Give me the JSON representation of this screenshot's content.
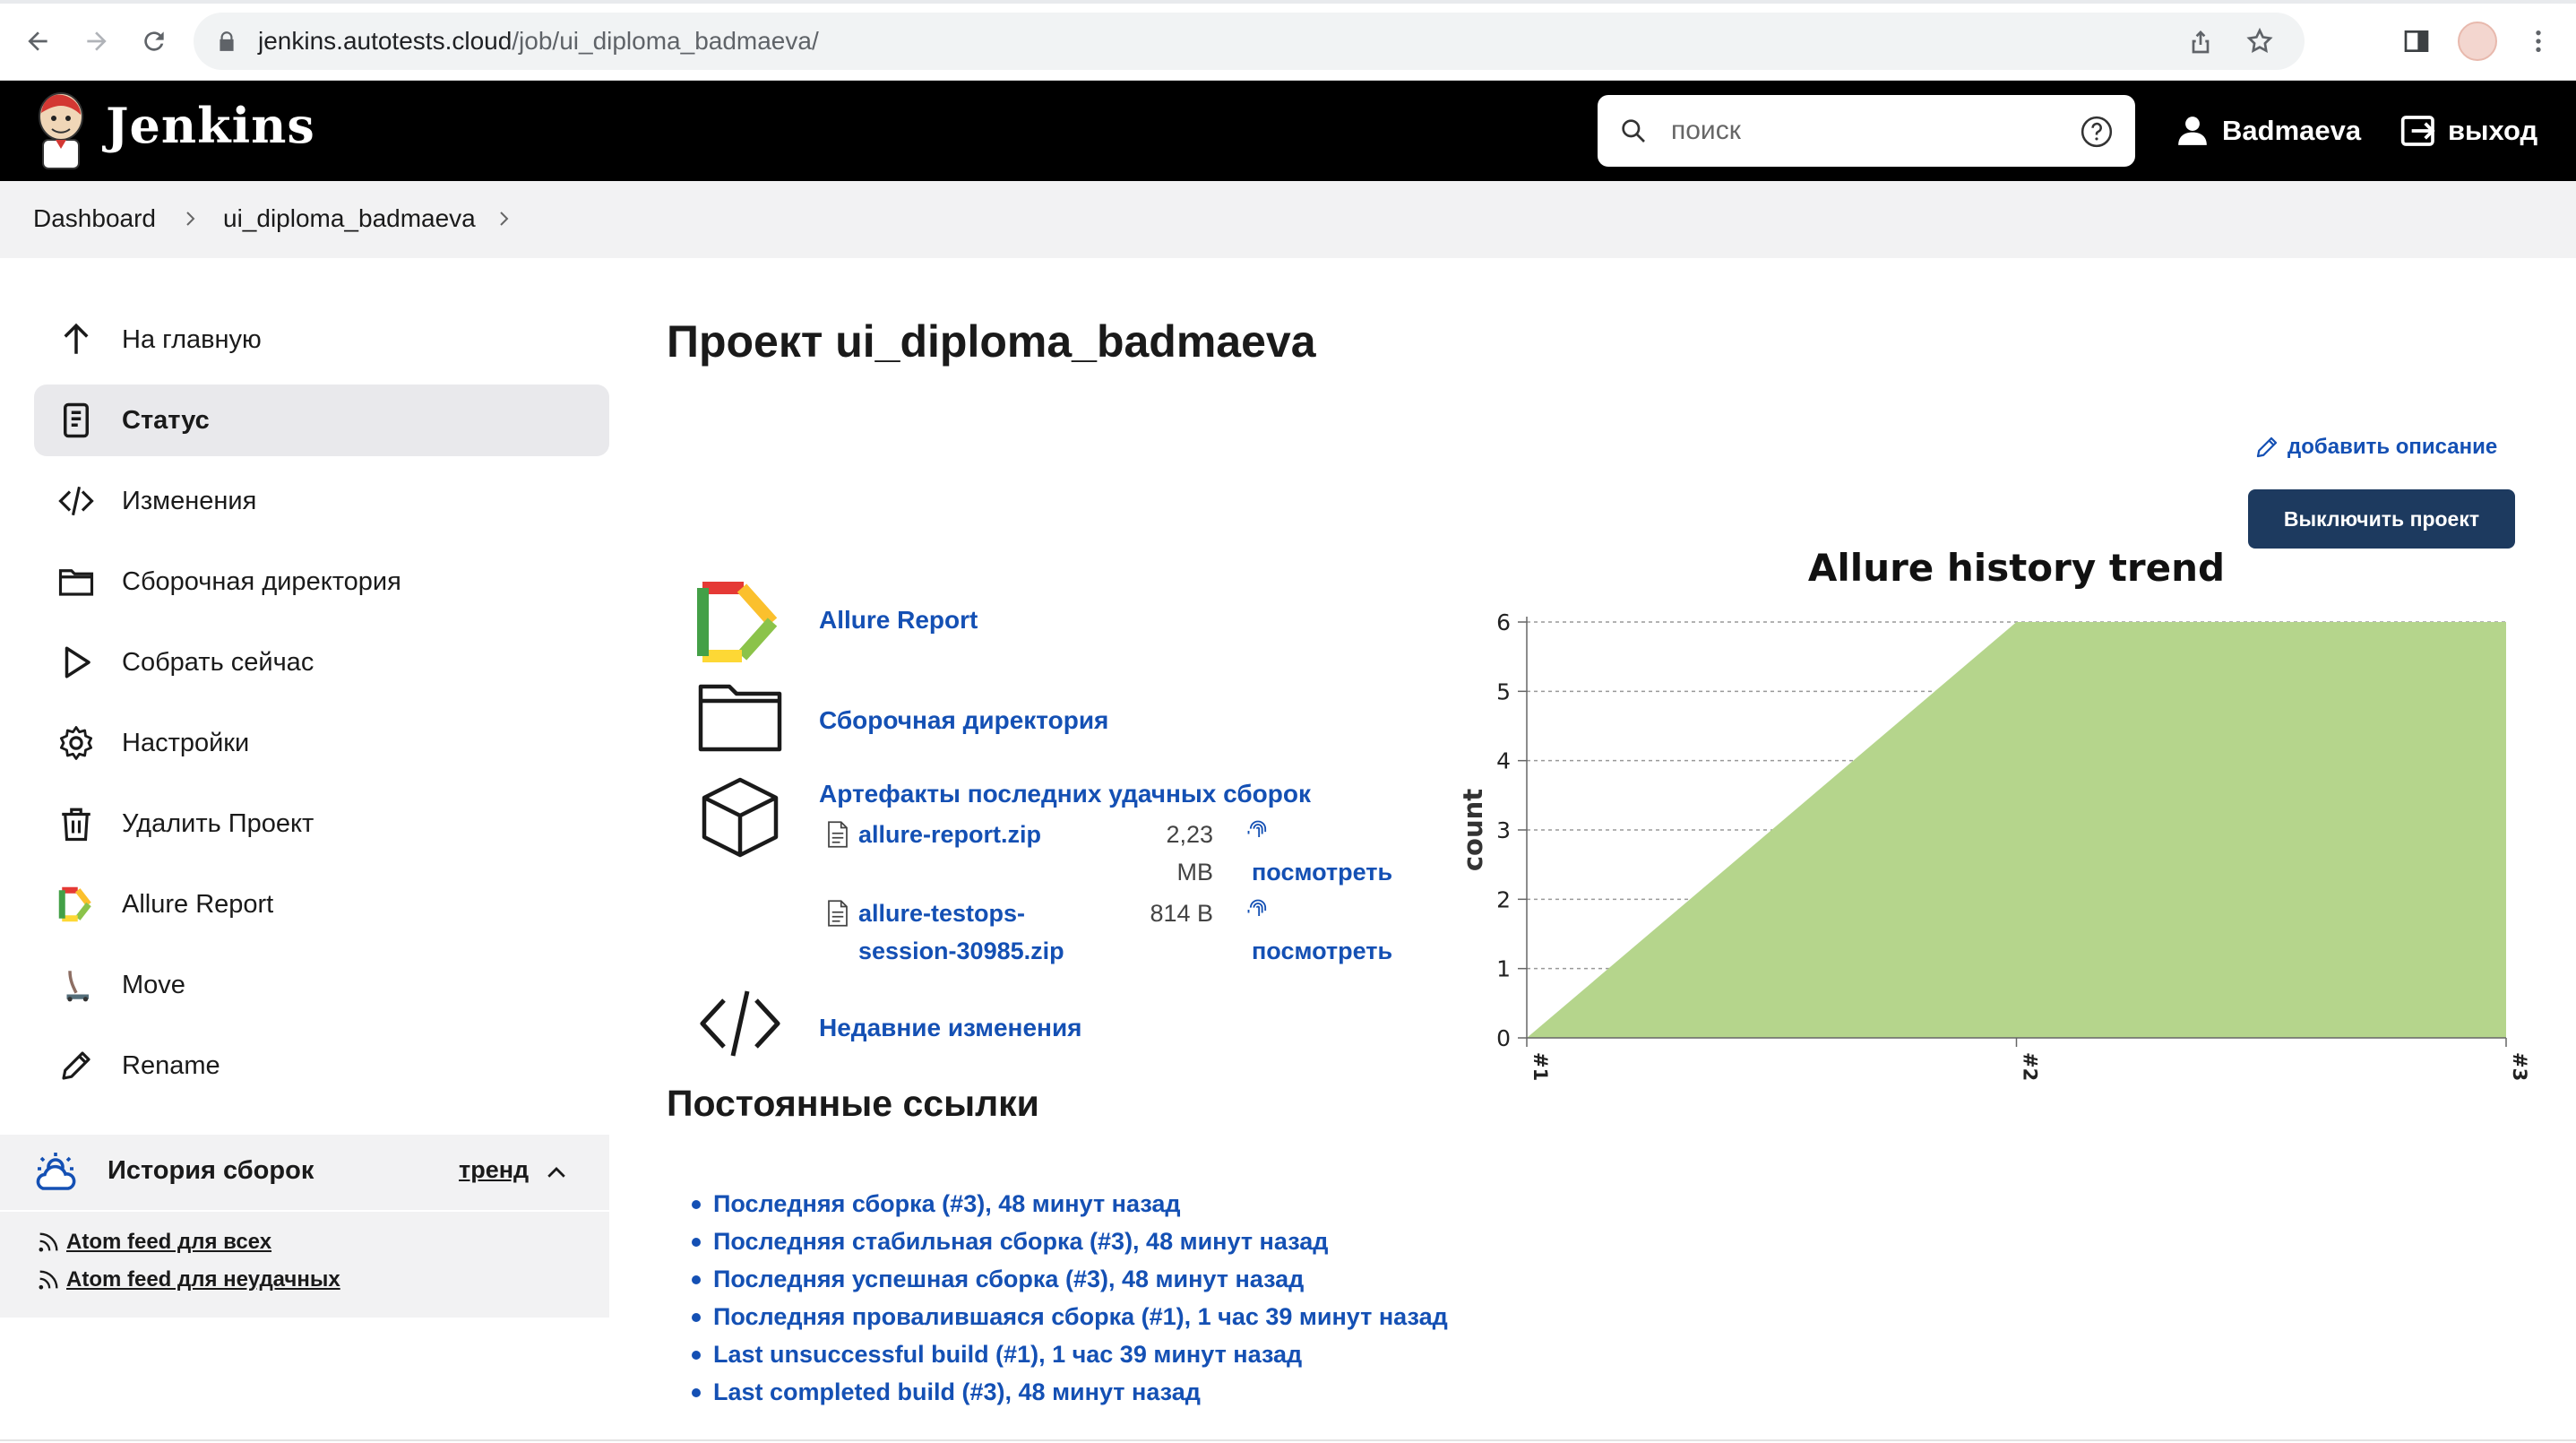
{
  "browser": {
    "url_host": "jenkins.autotests.cloud",
    "url_path": "/job/ui_diploma_badmaeva/"
  },
  "header": {
    "app_title": "Jenkins",
    "search_placeholder": "поиск",
    "user_name": "Badmaeva",
    "logout_label": "выход"
  },
  "breadcrumb": {
    "items": [
      "Dashboard",
      "ui_diploma_badmaeva"
    ]
  },
  "sidebar": {
    "items": [
      {
        "label": "На главную",
        "icon": "arrow-up-icon"
      },
      {
        "label": "Статус",
        "icon": "document-icon",
        "active": true
      },
      {
        "label": "Изменения",
        "icon": "code-icon"
      },
      {
        "label": "Сборочная директория",
        "icon": "folder-icon"
      },
      {
        "label": "Собрать сейчас",
        "icon": "play-icon"
      },
      {
        "label": "Настройки",
        "icon": "gear-icon"
      },
      {
        "label": "Удалить Проект",
        "icon": "trash-icon"
      },
      {
        "label": "Allure Report",
        "icon": "allure-icon"
      },
      {
        "label": "Move",
        "icon": "move-icon"
      },
      {
        "label": "Rename",
        "icon": "pencil-icon"
      }
    ],
    "history": {
      "title": "История сборок",
      "trend_label": "тренд",
      "feeds": [
        "Atom feed для всех",
        "Atom feed для неудачных"
      ]
    }
  },
  "main": {
    "title": "Проект ui_diploma_badmaeva",
    "add_description": "добавить описание",
    "disable_button": "Выключить проект",
    "links": {
      "allure": "Allure Report",
      "workspace": "Сборочная директория",
      "artifacts": "Артефакты последних удачных сборок",
      "changes": "Недавние изменения"
    },
    "artifacts": [
      {
        "name": "allure-report.zip",
        "size_line1": "2,23",
        "size_line2": "MB",
        "view": "посмотреть"
      },
      {
        "name_line1": "allure-testops-",
        "name_line2": "session-30985.zip",
        "size": "814 B",
        "view": "посмотреть"
      }
    ],
    "permalinks_title": "Постоянные ссылки",
    "permalinks": [
      "Последняя сборка (#3), 48 минут назад",
      "Последняя стабильная сборка (#3), 48 минут назад",
      "Последняя успешная сборка (#3), 48 минут назад",
      "Последняя провалившаяся сборка (#1), 1 час 39 минут назад",
      "Last unsuccessful build (#1), 1 час 39 минут назад",
      "Last completed build (#3), 48 минут назад"
    ]
  },
  "chart_data": {
    "type": "area",
    "title": "Allure history trend",
    "ylabel": "count",
    "xlabel": "",
    "x": [
      "#1",
      "#2",
      "#3"
    ],
    "series": [
      {
        "values": [
          0,
          6,
          6
        ],
        "color": "#b5d58c"
      }
    ],
    "ylim": [
      0,
      6
    ],
    "yticks": [
      0,
      1,
      2,
      3,
      4,
      5,
      6
    ],
    "grid": true
  }
}
